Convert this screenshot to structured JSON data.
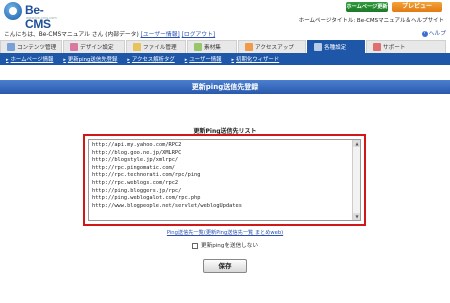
{
  "brand": {
    "name": "Be-CMS",
    "tagline": "www.be-cms.com"
  },
  "header": {
    "hp_update_button": "ホームページ更新",
    "preview_button": "プレビュー",
    "site_title": "ホームページタイトル: Be-CMSマニュアル＆ヘルプサイト",
    "greeting": "こんにちは、Be-CMSマニュアル さん (内部データ)",
    "user_info_link": "[ユーザー情報]",
    "logout_link": "[ログアウト]",
    "help": "ヘルプ"
  },
  "tabs": [
    {
      "label": "コンテンツ管理",
      "icon": "content-icon"
    },
    {
      "label": "デザイン設定",
      "icon": "design-icon"
    },
    {
      "label": "ファイル管理",
      "icon": "folder-icon"
    },
    {
      "label": "素材集",
      "icon": "materials-icon"
    },
    {
      "label": "アクセスアップ",
      "icon": "access-up-icon"
    },
    {
      "label": "各種設定",
      "icon": "settings-icon",
      "active": true
    },
    {
      "label": "サポート",
      "icon": "support-icon"
    }
  ],
  "subnav": [
    "ホームページ情報",
    "更新ping送信先登録",
    "アクセス解析タグ",
    "ユーザー情報",
    "初期化ウィザード"
  ],
  "page_title": "更新ping送信先登録",
  "ping_list": {
    "label": "更新Ping送信先リスト",
    "value": "http://api.my.yahoo.com/RPC2\nhttp://blog.goo.ne.jp/XMLRPC\nhttp://blogstyle.jp/xmlrpc/\nhttp://rpc.pingomatic.com/\nhttp://rpc.technorati.com/rpc/ping\nhttp://rpc.weblogs.com/rpc2\nhttp://ping.bloggers.jp/rpc/\nhttp://ping.weblogalot.com/rpc.php\nhttp://www.blogpeople.net/servlet/weblogUpdates"
  },
  "bottom_link": "Ping送信先一覧(更新Ping送信先一覧 まとめweb)",
  "no_ping_checkbox_label": "更新pingを送信しない",
  "save_button": "保存",
  "colors": {
    "nav_blue": "#1f57a8",
    "highlight_red": "#d11818"
  }
}
